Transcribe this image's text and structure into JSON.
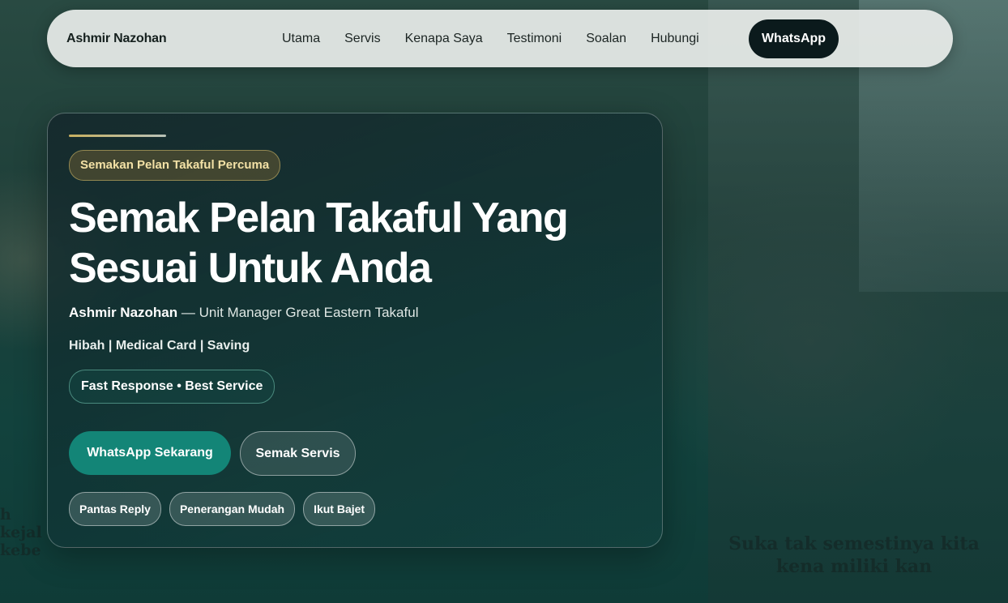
{
  "nav": {
    "brand": "Ashmir Nazohan",
    "links": [
      "Utama",
      "Servis",
      "Kenapa Saya",
      "Testimoni",
      "Soalan",
      "Hubungi"
    ],
    "cta": "WhatsApp"
  },
  "hero": {
    "eyebrow": "Semakan Pelan Takaful Percuma",
    "headline_line1": "Semak Pelan Takaful Yang",
    "headline_line2": "Sesuai Untuk Anda",
    "name": "Ashmir Nazohan",
    "role": " — Unit Manager Great Eastern Takaful",
    "services": "Hibah | Medical Card | Saving",
    "badge": "Fast Response • Best Service",
    "primary_cta": "WhatsApp Sekarang",
    "secondary_cta": "Semak Servis",
    "chips": [
      "Pantas Reply",
      "Penerangan Mudah",
      "Ikut Bajet"
    ]
  },
  "background": {
    "caption_right": "Suka tak semestinya kita kena miliki kan",
    "caption_left": "h kejal kebe"
  },
  "colors": {
    "accent_teal": "#138577",
    "nav_cta_bg": "#0b1a1c",
    "eyebrow_text": "#f3e1a6"
  }
}
